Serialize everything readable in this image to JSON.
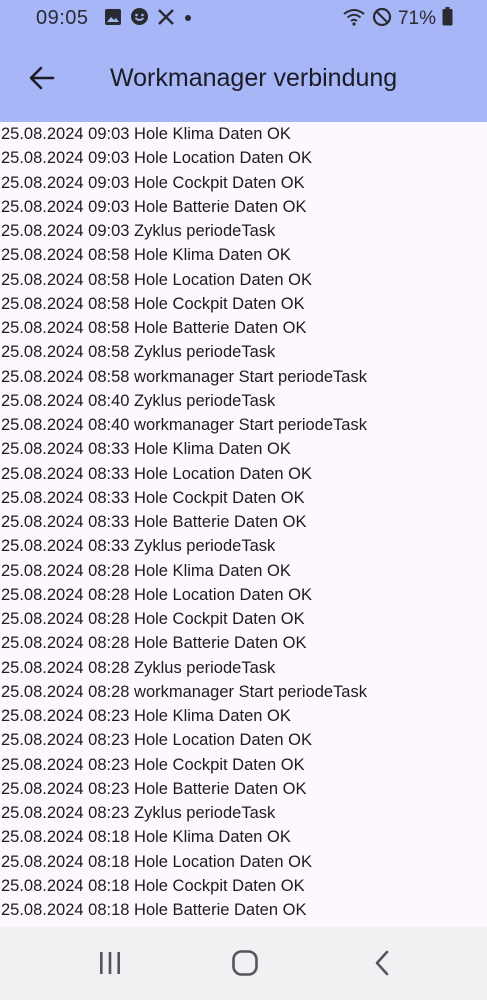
{
  "status_bar": {
    "time": "09:05",
    "battery_percent": "71%",
    "left_icons": [
      "gallery-icon",
      "face-icon",
      "x-icon",
      "dot-icon"
    ],
    "right_icons": [
      "wifi-icon",
      "do-not-disturb-icon",
      "battery-icon"
    ]
  },
  "app_bar": {
    "title": "Workmanager verbindung",
    "back_icon": "arrow-back-icon",
    "background": "#a6b6f7"
  },
  "log": {
    "entries": [
      "25.08.2024 09:03 Hole Klima Daten OK",
      "25.08.2024 09:03 Hole Location Daten OK",
      "25.08.2024 09:03 Hole Cockpit Daten OK",
      "25.08.2024 09:03 Hole Batterie Daten OK",
      "25.08.2024 09:03 Zyklus periodeTask",
      "25.08.2024 08:58 Hole Klima Daten OK",
      "25.08.2024 08:58 Hole Location Daten OK",
      "25.08.2024 08:58 Hole Cockpit Daten OK",
      "25.08.2024 08:58 Hole Batterie Daten OK",
      "25.08.2024 08:58 Zyklus periodeTask",
      "25.08.2024 08:58 workmanager Start periodeTask",
      "25.08.2024 08:40 Zyklus periodeTask",
      "25.08.2024 08:40 workmanager Start periodeTask",
      "25.08.2024 08:33 Hole Klima Daten OK",
      "25.08.2024 08:33 Hole Location Daten OK",
      "25.08.2024 08:33 Hole Cockpit Daten OK",
      "25.08.2024 08:33 Hole Batterie Daten OK",
      "25.08.2024 08:33 Zyklus periodeTask",
      "25.08.2024 08:28 Hole Klima Daten OK",
      "25.08.2024 08:28 Hole Location Daten OK",
      "25.08.2024 08:28 Hole Cockpit Daten OK",
      "25.08.2024 08:28 Hole Batterie Daten OK",
      "25.08.2024 08:28 Zyklus periodeTask",
      "25.08.2024 08:28 workmanager Start periodeTask",
      "25.08.2024 08:23 Hole Klima Daten OK",
      "25.08.2024 08:23 Hole Location Daten OK",
      "25.08.2024 08:23 Hole Cockpit Daten OK",
      "25.08.2024 08:23 Hole Batterie Daten OK",
      "25.08.2024 08:23 Zyklus periodeTask",
      "25.08.2024 08:18 Hole Klima Daten OK",
      "25.08.2024 08:18 Hole Location Daten OK",
      "25.08.2024 08:18 Hole Cockpit Daten OK",
      "25.08.2024 08:18 Hole Batterie Daten OK"
    ]
  },
  "nav_bar": {
    "buttons": [
      "recent-apps-icon",
      "home-icon",
      "back-icon"
    ]
  }
}
